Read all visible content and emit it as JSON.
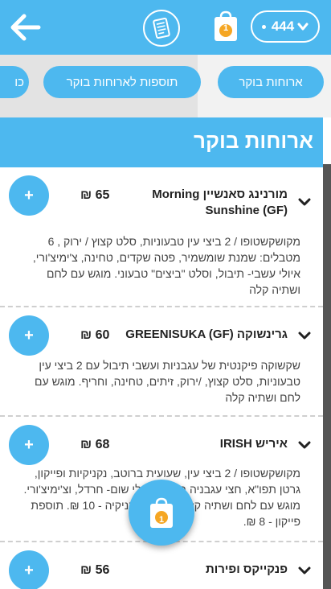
{
  "header": {
    "points": "444",
    "cart_count": "1"
  },
  "categories": [
    {
      "label": "ארוחות בוקר"
    },
    {
      "label": "תוספות לארוחות בוקר"
    },
    {
      "label": "כו"
    }
  ],
  "section": {
    "title": "ארוחות בוקר"
  },
  "items": [
    {
      "name": "מורנינג סאנשיין Morning Sunshine (GF)",
      "price": "65 ₪",
      "description": "מקושקשטופו / 2 ביצי עין טבעוניות, סלט קצוץ / ירוק , 6 מטבלים: שמנת שומשמיר, פטה שקדים, טחינה, צ'ימיצ'ורי, איולי עשבי- תיבול, וסלט \"ביצים\" טבעוני. מוגש עם לחם ושתיה קלה"
    },
    {
      "name": "גרינשוקה GREENISUKA (GF)",
      "price": "60 ₪",
      "description": "שקשוקה פיקנטית של עגבניות ועשבי תיבול עם 2 ביצי עין טבעוניות, סלט קצוץ, /ירוק, זיתים, טחינה, וחריף. מוגש עם לחם ושתיה קלה"
    },
    {
      "name": "איריש IRISH",
      "price": "68 ₪",
      "description": "מקושקשטופו / 2 ביצי עין, שעועית ברוטב, נקניקיות ופייקון, גרטן תפו\"א, חצי עגבניה בגריל, איולי שום- חרדל, וצ'ימיצ'ורי. מוגש עם לחם ושתיה קלה. תוספת נקניקיה - 10 ₪. תוספת פייקון - 8 ₪."
    },
    {
      "name": "פנקייקס ופירות",
      "price": "56 ₪",
      "description": ""
    }
  ],
  "icons": {
    "back": "arrow-left-icon",
    "menu": "menu-icon",
    "bag": "shopping-bag-icon",
    "chevron": "chevron-down-icon",
    "add": "plus-icon"
  },
  "add_label": "+",
  "colors": {
    "accent": "#4db8ef",
    "badge": "#f5a623"
  }
}
